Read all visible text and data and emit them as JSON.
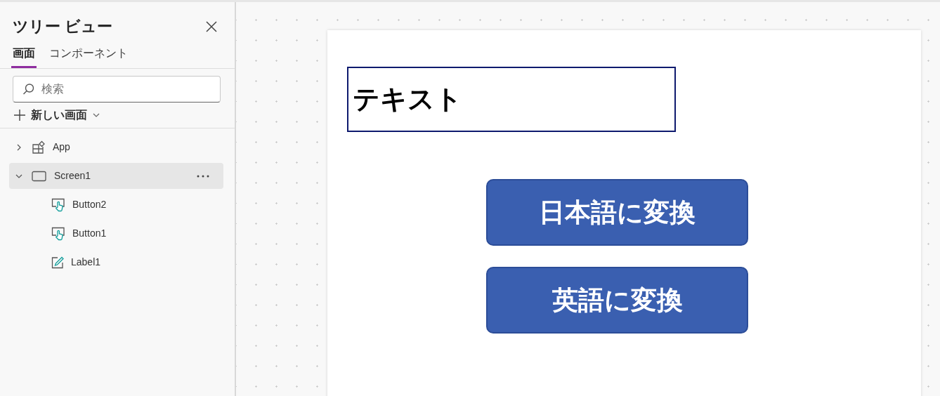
{
  "panel": {
    "title": "ツリー ビュー",
    "tabs": [
      {
        "label": "画面",
        "selected": true
      },
      {
        "label": "コンポーネント",
        "selected": false
      }
    ],
    "search": {
      "placeholder": "検索"
    },
    "new_screen": "新しい画面"
  },
  "tree": [
    {
      "kind": "app",
      "label": "App",
      "expanded": false,
      "selected": false
    },
    {
      "kind": "screen",
      "label": "Screen1",
      "expanded": true,
      "selected": true,
      "children": [
        {
          "kind": "button",
          "label": "Button2",
          "selected": false
        },
        {
          "kind": "button",
          "label": "Button1",
          "selected": false
        },
        {
          "kind": "label",
          "label": "Label1",
          "selected": false
        }
      ]
    }
  ],
  "canvas": {
    "controls": [
      {
        "kind": "label",
        "text": "テキスト"
      },
      {
        "kind": "button",
        "text": "日本語に変換"
      },
      {
        "kind": "button",
        "text": "英語に変換"
      }
    ]
  }
}
